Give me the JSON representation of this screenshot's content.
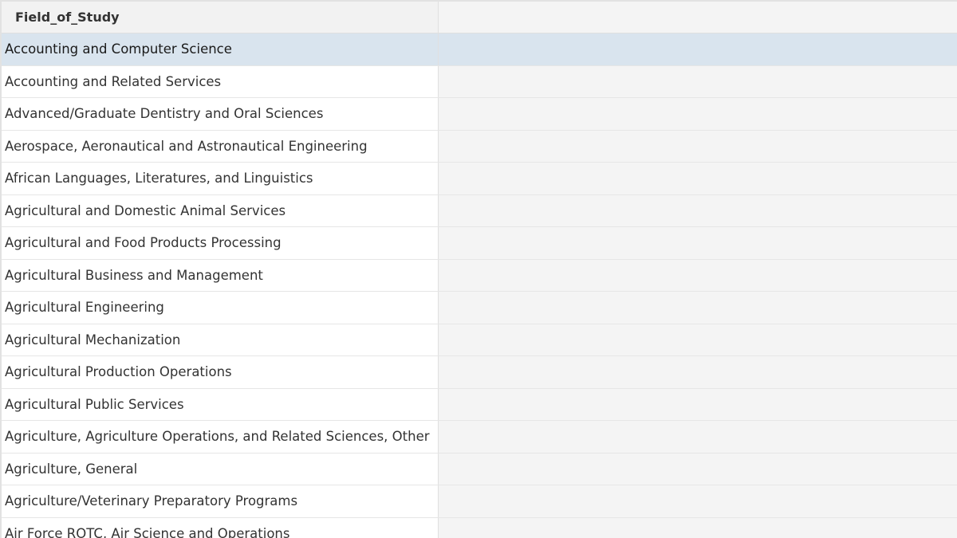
{
  "table": {
    "column_header": "Field_of_Study",
    "selected_index": 0,
    "rows": [
      "Accounting and Computer Science",
      "Accounting and Related Services",
      "Advanced/Graduate Dentistry and Oral Sciences",
      "Aerospace, Aeronautical and Astronautical Engineering",
      "African Languages, Literatures, and Linguistics",
      "Agricultural and Domestic Animal Services",
      "Agricultural and Food Products Processing",
      "Agricultural Business and Management",
      "Agricultural Engineering",
      "Agricultural Mechanization",
      "Agricultural Production Operations",
      "Agricultural Public Services",
      "Agriculture, Agriculture Operations, and Related Sciences, Other",
      "Agriculture, General",
      "Agriculture/Veterinary Preparatory Programs",
      "Air Force ROTC, Air Science and Operations"
    ]
  },
  "colors": {
    "selected_row": "#d9e4ee",
    "cell_background": "#ffffff",
    "empty_area": "#f4f4f4",
    "grid_line": "#e0e0e0",
    "text": "#333333"
  }
}
